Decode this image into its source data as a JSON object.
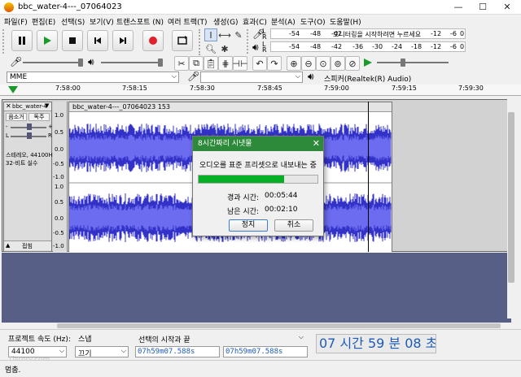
{
  "window": {
    "title": "bbc_water-4---_07064023",
    "min": "—",
    "max": "☐",
    "close": "✕"
  },
  "menu": [
    "파일(F)",
    "편집(E)",
    "선택(S)",
    "보기(V)",
    "트랜스포트 (N)",
    "여러 트랙(T)",
    "생성(G)",
    "효과(C)",
    "분석(A)",
    "도구(O)",
    "도움말(H)"
  ],
  "meter": {
    "record_ticks": [
      "-54",
      "-48",
      "-42",
      "모니터링을 시작하려면 누르세요",
      "-12",
      "-6",
      "0"
    ],
    "play_ticks": [
      "-54",
      "-48",
      "-42",
      "-36",
      "-30",
      "-24",
      "-18",
      "-12",
      "-6",
      "0"
    ]
  },
  "device": {
    "host": "MME",
    "output": "스피커(Realtek(R) Audio)"
  },
  "ruler": {
    "ticks": [
      "7:58:00",
      "7:58:15",
      "7:58:30",
      "7:58:45",
      "7:59:00",
      "7:59:15",
      "7:59:30"
    ]
  },
  "track": {
    "name_short": "bbc_water-4",
    "clip_name": "bbc_water-4---_07064023 153",
    "mute": "음소거",
    "solo": "독주",
    "info_line1": "스테레오, 44100Hz",
    "info_line2": "32-비트 실수",
    "collapse": "접힘",
    "scale_top": [
      "1.0",
      "0.5",
      "0.0",
      "-0.5",
      "-1.0"
    ],
    "scale_bottom": [
      "1.0",
      "0.5",
      "0.0",
      "-0.5",
      "-1.0"
    ]
  },
  "dialog": {
    "title": "8시간짜리 시냇물",
    "message": "오디오를 표준 프리셋으로 내보내는 중",
    "progress": 0.72,
    "elapsed_label": "경과 시간:",
    "elapsed_value": "00:05:44",
    "remaining_label": "남은 시간:",
    "remaining_value": "00:02:10",
    "stop": "정지",
    "cancel": "취소"
  },
  "selection": {
    "rate_label": "프로젝트 속도 (Hz):",
    "rate_value": "44100",
    "snap_label": "스냅",
    "snap_value": "끄기",
    "range_label": "선택의 시작과 끝",
    "start": "07h59m07.588s",
    "end": "07h59m07.588s",
    "big_time": "07 시간 59 분 08 초"
  },
  "status": {
    "text": "멈춤."
  },
  "watermark": "Tistory.com",
  "colors": {
    "waveform": "#3232c8",
    "waveform_light": "#6c6cf0",
    "track_bg": "#d2d2d2",
    "dialog_title": "#2c8a3a",
    "progress": "#06b025",
    "empty": "#575f87",
    "time_text": "#1d5bb8"
  }
}
